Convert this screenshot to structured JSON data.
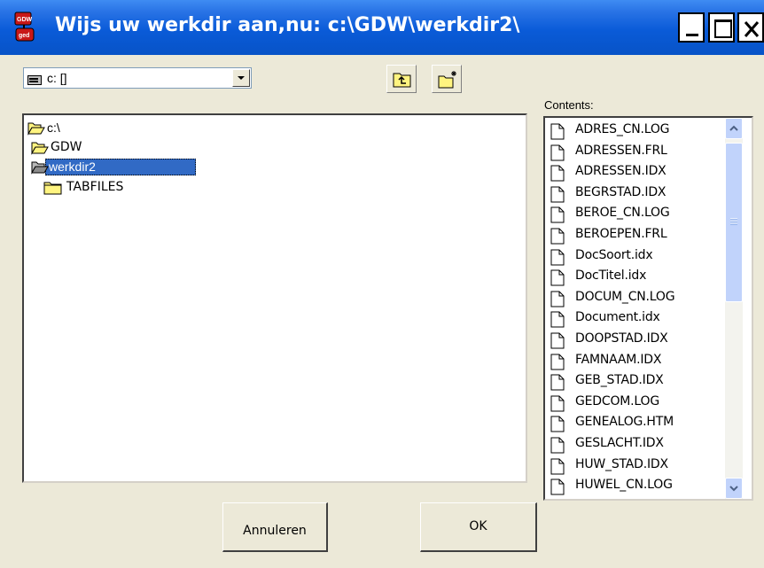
{
  "window": {
    "title": "Wijs uw werkdir aan,nu: c:\\GDW\\werkdir2\\"
  },
  "drive": {
    "selected": "c: []"
  },
  "tree": {
    "items": [
      {
        "label": "c:\\"
      },
      {
        "label": "GDW"
      },
      {
        "label": "werkdir2"
      },
      {
        "label": "TABFILES"
      }
    ]
  },
  "contents": {
    "label": "Contents:",
    "files": [
      "ADRES_CN.LOG",
      "ADRESSEN.FRL",
      "ADRESSEN.IDX",
      "BEGRSTAD.IDX",
      "BEROE_CN.LOG",
      "BEROEPEN.FRL",
      "DocSoort.idx",
      "DocTitel.idx",
      "DOCUM_CN.LOG",
      "Document.idx",
      "DOOPSTAD.IDX",
      "FAMNAAM.IDX",
      "GEB_STAD.IDX",
      "GEDCOM.LOG",
      "GENEALOG.HTM",
      "GESLACHT.IDX",
      "HUW_STAD.IDX",
      "HUWEL_CN.LOG"
    ]
  },
  "buttons": {
    "cancel": "Annuleren",
    "ok": "OK"
  },
  "colors": {
    "titlebar": "#0a5bd8",
    "selection": "#316ac5",
    "dialog_bg": "#ece9d8"
  },
  "icons": {
    "app": "app-icon",
    "drive": "hard-drive-icon",
    "up_folder": "up-folder-icon",
    "new_folder": "new-folder-icon",
    "folder_open": "open-folder-icon",
    "folder_closed": "folder-icon",
    "file": "file-icon"
  }
}
